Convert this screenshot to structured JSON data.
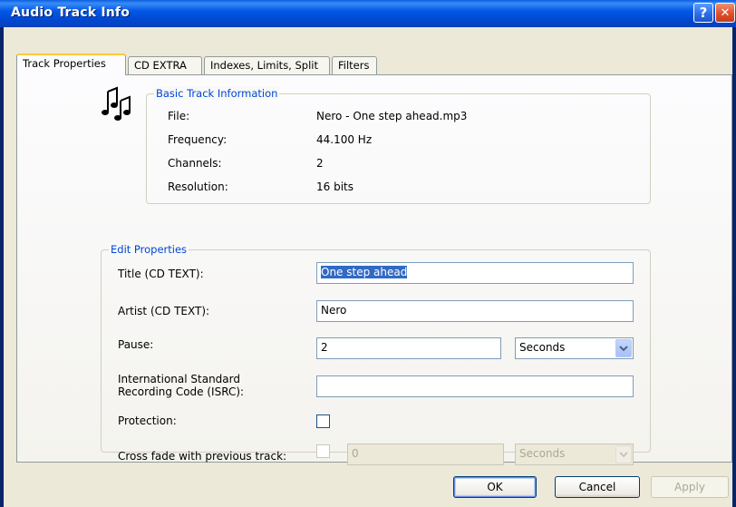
{
  "window": {
    "title": "Audio Track Info",
    "help_icon": "?",
    "close_icon": "✕"
  },
  "tabs": [
    {
      "label": "Track Properties",
      "active": true
    },
    {
      "label": "CD EXTRA",
      "active": false
    },
    {
      "label": "Indexes, Limits, Split",
      "active": false
    },
    {
      "label": "Filters",
      "active": false
    }
  ],
  "basic_info": {
    "group_label": "Basic Track Information",
    "icon": "music-notes-icon",
    "rows": [
      {
        "label": "File:",
        "value": "Nero - One step ahead.mp3"
      },
      {
        "label": "Frequency:",
        "value": "44.100 Hz"
      },
      {
        "label": "Channels:",
        "value": "2"
      },
      {
        "label": "Resolution:",
        "value": "16 bits"
      }
    ]
  },
  "edit": {
    "group_label": "Edit Properties",
    "title_label": "Title (CD TEXT):",
    "title_value": "One step ahead",
    "artist_label": "Artist (CD TEXT):",
    "artist_value": "Nero",
    "pause_label": "Pause:",
    "pause_value": "2",
    "pause_unit": "Seconds",
    "isrc_label_line1": "International Standard",
    "isrc_label_line2": "Recording Code (ISRC):",
    "isrc_value": "",
    "protection_label": "Protection:",
    "protection_checked": false,
    "crossfade_label": "Cross fade with previous track:",
    "crossfade_checked": false,
    "crossfade_value": "0",
    "crossfade_unit": "Seconds"
  },
  "buttons": {
    "ok": "OK",
    "cancel": "Cancel",
    "apply": "Apply"
  },
  "colors": {
    "titlebar": "#0054E3",
    "group_label": "#0046D5",
    "selection": "#316AC5",
    "dialog_bg": "#ECE9D8"
  }
}
